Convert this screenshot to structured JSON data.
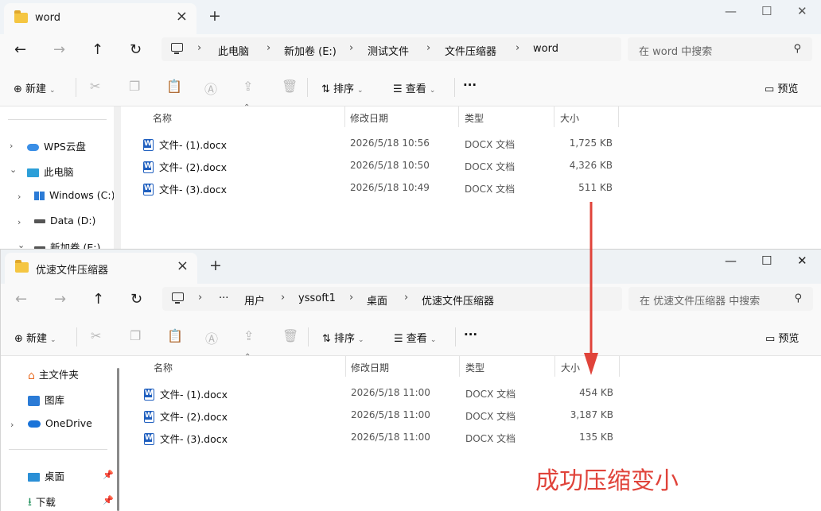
{
  "window1": {
    "tab_title": "word",
    "new_tab": "+",
    "breadcrumb": [
      "此电脑",
      "新加卷 (E:)",
      "测试文件",
      "文件压缩器",
      "word"
    ],
    "search_placeholder": "在 word 中搜索",
    "toolbar": {
      "new": "新建",
      "sort": "排序",
      "view": "查看",
      "more": "···",
      "preview": "预览"
    },
    "columns": [
      "名称",
      "修改日期",
      "类型",
      "大小"
    ],
    "sidebar": [
      {
        "label": "WPS云盘",
        "chevron": "›"
      },
      {
        "label": "此电脑",
        "chevron": "⌄"
      },
      {
        "label": "Windows (C:)",
        "chevron": "›"
      },
      {
        "label": "Data (D:)",
        "chevron": "›"
      },
      {
        "label": "新加卷 (E:)",
        "chevron": "⌄"
      }
    ],
    "files": [
      {
        "name": "文件- (1).docx",
        "date": "2026/5/18 10:56",
        "type": "DOCX 文档",
        "size": "1,725 KB"
      },
      {
        "name": "文件- (2).docx",
        "date": "2026/5/18 10:50",
        "type": "DOCX 文档",
        "size": "4,326 KB"
      },
      {
        "name": "文件- (3).docx",
        "date": "2026/5/18 10:49",
        "type": "DOCX 文档",
        "size": "511 KB"
      }
    ]
  },
  "window2": {
    "tab_title": "优速文件压缩器",
    "new_tab": "+",
    "breadcrumb": [
      "···",
      "用户",
      "yssoft1",
      "桌面",
      "优速文件压缩器"
    ],
    "search_placeholder": "在 优速文件压缩器 中搜索",
    "toolbar": {
      "new": "新建",
      "sort": "排序",
      "view": "查看",
      "more": "···",
      "preview": "预览"
    },
    "columns": [
      "名称",
      "修改日期",
      "类型",
      "大小"
    ],
    "sidebar": [
      {
        "label": "主文件夹",
        "chevron": ""
      },
      {
        "label": "图库",
        "chevron": ""
      },
      {
        "label": "OneDrive",
        "chevron": "›"
      },
      {
        "label": "桌面",
        "chevron": ""
      },
      {
        "label": "下载",
        "chevron": ""
      }
    ],
    "files": [
      {
        "name": "文件- (1).docx",
        "date": "2026/5/18 11:00",
        "type": "DOCX 文档",
        "size": "454 KB"
      },
      {
        "name": "文件- (2).docx",
        "date": "2026/5/18 11:00",
        "type": "DOCX 文档",
        "size": "3,187 KB"
      },
      {
        "name": "文件- (3).docx",
        "date": "2026/5/18 11:00",
        "type": "DOCX 文档",
        "size": "135 KB"
      }
    ]
  },
  "annotation": {
    "text": "成功压缩变小",
    "color": "#e0433a"
  },
  "colors": {
    "accent": "#1f5fbf",
    "folder": "#f5c642",
    "titlebar": "#eff3f7"
  }
}
